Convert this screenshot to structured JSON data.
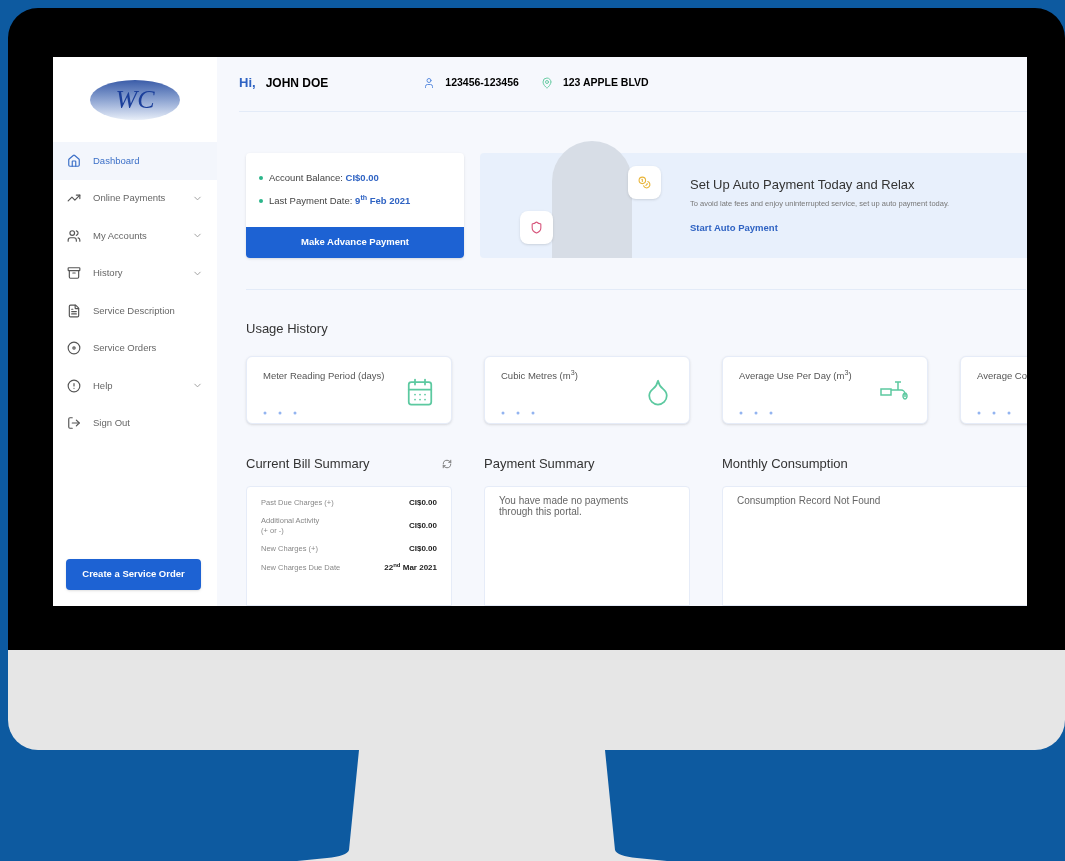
{
  "logo": {
    "text": "WC"
  },
  "header": {
    "greeting": "Hi,",
    "name": "JOHN DOE",
    "account_number": "123456-123456",
    "address": "123 APPLE BLVD"
  },
  "sidebar": {
    "items": [
      {
        "label": "Dashboard",
        "selected": true,
        "expandable": false
      },
      {
        "label": "Online Payments",
        "selected": false,
        "expandable": true
      },
      {
        "label": "My Accounts",
        "selected": false,
        "expandable": true
      },
      {
        "label": "History",
        "selected": false,
        "expandable": true
      },
      {
        "label": "Service Description",
        "selected": false,
        "expandable": false
      },
      {
        "label": "Service Orders",
        "selected": false,
        "expandable": false
      },
      {
        "label": "Help",
        "selected": false,
        "expandable": true
      },
      {
        "label": "Sign Out",
        "selected": false,
        "expandable": false
      }
    ],
    "button": "Create a Service Order"
  },
  "account_card": {
    "lines": [
      {
        "label": "Account Balance:",
        "value": "CI$0.00"
      },
      {
        "label": "Last Payment Date:",
        "value": "9$^{th}$ Feb 2021"
      }
    ],
    "button": "Make Advance Payment"
  },
  "banner": {
    "title": "Set Up Auto Payment Today and Relax",
    "text": "To avoid late fees and enjoy uninterrupted service, set up auto payment today.",
    "link": "Start Auto Payment"
  },
  "usage_history": {
    "title": "Usage History",
    "cards": [
      {
        "label": "Meter Reading Period (days)",
        "kind": "calendar"
      },
      {
        "label": "Cubic Metres (m$^{3}$)",
        "kind": "drop"
      },
      {
        "label": "Average Use Per Day (m$^{3}$)",
        "kind": "tap"
      },
      {
        "label": "Average Co",
        "kind": "none"
      }
    ]
  },
  "bill_summary": {
    "title": "Current Bill Summary",
    "rows": [
      {
        "label": "Past Due Charges (+)",
        "value": "CI$0.00"
      },
      {
        "label": "Additional Activity\n(+ or -)",
        "value": "CI$0.00"
      },
      {
        "label": "New Charges (+)",
        "value": "CI$0.00"
      },
      {
        "label": "New Charges Due Date",
        "value": "22$^{nd}$ Mar 2021"
      }
    ]
  },
  "payment_summary": {
    "title": "Payment Summary",
    "message": "You have made no payments through this portal."
  },
  "monthly_consumption": {
    "title": "Monthly Consumption",
    "message": "Consumption Record Not Found"
  }
}
